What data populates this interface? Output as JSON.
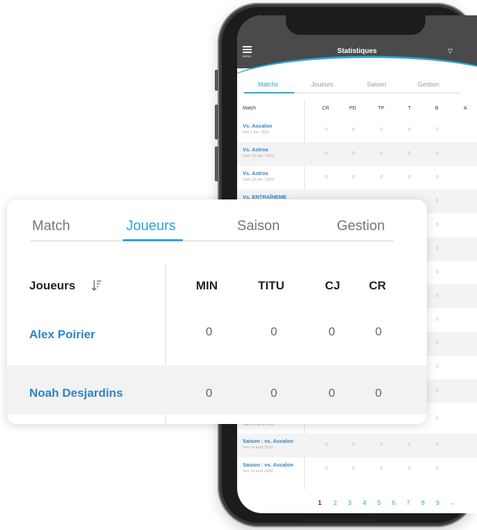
{
  "phone": {
    "menu_label": "MENU",
    "title": "Statistiques",
    "filter_icon": "filter-icon",
    "tabs": [
      "Matchs",
      "Joueurs",
      "Saison",
      "Gestion"
    ],
    "active_tab": "Matchs",
    "columns": [
      "Match",
      "CR",
      "PD",
      "TP",
      "T",
      "B",
      "A"
    ],
    "rows": [
      {
        "name": "Vs. Ascalon",
        "date": "Ven 1 jan. 2021",
        "values": [
          "0",
          "0",
          "0",
          "0",
          "0"
        ]
      },
      {
        "name": "Vs. Astros",
        "date": "Sam 19 déc. 2020",
        "values": [
          "0",
          "0",
          "0",
          "0",
          "0"
        ]
      },
      {
        "name": "Vs. Astros",
        "date": "Sam 19 déc. 2020",
        "values": [
          "0",
          "0",
          "0",
          "0",
          "0"
        ]
      },
      {
        "name": "Vs. ENTRAÎNEME",
        "date": "",
        "values": [
          "",
          "",
          "",
          "",
          "0"
        ]
      }
    ],
    "right_col_values": [
      "0",
      "0",
      "0",
      "0",
      "0",
      "0",
      "0",
      "0",
      "0"
    ],
    "bottom_rows": [
      {
        "name": "",
        "date": "Sam 15 août 2020",
        "values": [
          "",
          "",
          "",
          "",
          "0"
        ]
      },
      {
        "name": "Saison : vs. Ascalon",
        "date": "Ven 14 août 2020",
        "values": [
          "0",
          "0",
          "0",
          "0",
          "0"
        ]
      },
      {
        "name": "Saison : vs. Ascalon",
        "date": "Ven 14 août 2020",
        "values": [
          "0",
          "0",
          "0",
          "0",
          "0"
        ]
      }
    ],
    "pages": [
      "1",
      "2",
      "3",
      "4",
      "5",
      "6",
      "7",
      "8",
      "9",
      "→"
    ],
    "current_page": "1",
    "accent_color": "#2aa6d9",
    "header_color": "#4a4a4a"
  },
  "card": {
    "tabs": [
      "Match",
      "Joueurs",
      "Saison",
      "Gestion"
    ],
    "active_tab": "Joueurs",
    "players_header": "Joueurs",
    "sort_icon": "sort-descending-icon",
    "columns": [
      "MIN",
      "TITU",
      "CJ",
      "CR"
    ],
    "players": [
      {
        "name": "Alex Poirier",
        "values": [
          "0",
          "0",
          "0",
          "0"
        ]
      },
      {
        "name": "Noah Desjardins",
        "values": [
          "0",
          "0",
          "0",
          "0"
        ]
      }
    ]
  }
}
